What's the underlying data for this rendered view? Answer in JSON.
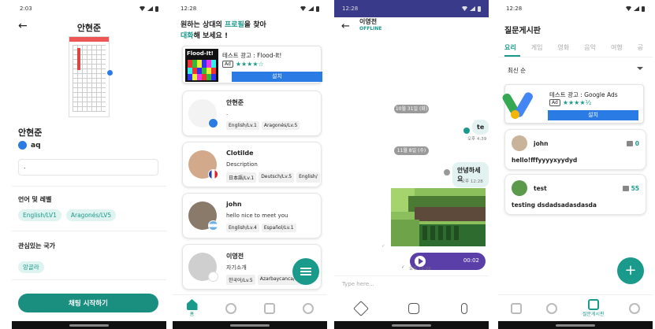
{
  "profile": {
    "time": "2:03",
    "title": "안현준",
    "name": "안현준",
    "user_id": "aq",
    "bio": ".",
    "lang_label": "언어 및 레벨",
    "langs": [
      "English/LV1",
      "Aragonés/LV5"
    ],
    "interest_label": "관심있는 국가",
    "interests": [
      "앙골라"
    ],
    "start_button": "채팅 시작하기"
  },
  "partners": {
    "time": "12:28",
    "headline_1": "원하는 상대의 ",
    "headline_hl1": "프로필",
    "headline_2": "을 찾아",
    "headline_hl2": "대화",
    "headline_3": "해 보세요 !",
    "ad": {
      "logo_text": "Flood-It!",
      "title": "테스트 광고 : Flood-It!",
      "badge": "Ad",
      "stars": "★★★★☆",
      "install": "설치"
    },
    "users": [
      {
        "name": "안현준",
        "desc": ".",
        "langs": [
          "English/Lv.1",
          "Aragonés/Lv.5"
        ]
      },
      {
        "name": "Clotilde",
        "desc": "Description",
        "langs": [
          "日本語/Lv.1",
          "Deutsch/Lv.5",
          "English/"
        ]
      },
      {
        "name": "john",
        "desc": "hello nice to meet you",
        "langs": [
          "English/Lv.4",
          "Español/Lv.1"
        ]
      },
      {
        "name": "이영전",
        "desc": "자기소개",
        "langs": [
          "한국어/Lv.5",
          "Azarbaycanca/Lv"
        ]
      }
    ],
    "nav_home": "홈",
    "colors": {
      "accent": "#1a9a8b",
      "install": "#2b7be4"
    }
  },
  "chat": {
    "time": "12:28",
    "name": "이영전",
    "status": "OFFLINE",
    "date1": "10월 31일 (화)",
    "msg1": "te",
    "meta1": "오후 4:39",
    "date2": "11월 8일 (수)",
    "msg2": "안녕하세요",
    "meta2": "오후 12:28",
    "meta3": "오후 12:28",
    "voice_time": "00:02",
    "input_placeholder": "Type here..."
  },
  "board": {
    "time": "12:28",
    "title": "질문게시판",
    "tabs": [
      "요리",
      "게임",
      "영화",
      "음악",
      "여행",
      "공"
    ],
    "sort": "최신 순",
    "ad": {
      "title": "테스트 광고 : Google Ads",
      "badge": "Ad",
      "stars": "★★★★½",
      "install": "설치"
    },
    "posts": [
      {
        "name": "john",
        "likes": "0",
        "body": "hello!fffyyyyxyydyd"
      },
      {
        "name": "test",
        "likes": "55",
        "body": "testing dsdadsadasdasda"
      }
    ],
    "nav_board": "질문게시판"
  }
}
